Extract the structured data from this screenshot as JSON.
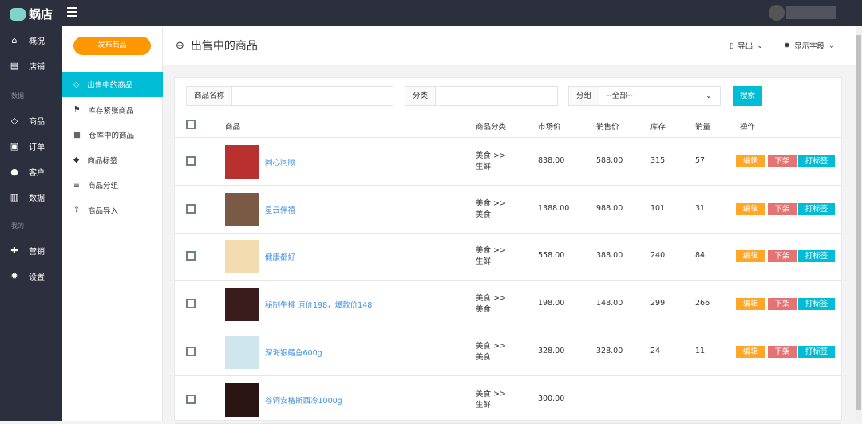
{
  "app": {
    "name": "蜗店"
  },
  "nav": {
    "items": [
      {
        "label": "概况",
        "icon": "home-icon",
        "glyph": "⌂"
      },
      {
        "label": "店铺",
        "icon": "store-icon",
        "glyph": "▤"
      }
    ],
    "section1": "数据",
    "items2": [
      {
        "label": "商品",
        "icon": "tag-icon",
        "glyph": "◇"
      },
      {
        "label": "订单",
        "icon": "order-icon",
        "glyph": "▣"
      },
      {
        "label": "客户",
        "icon": "user-icon",
        "glyph": "●"
      },
      {
        "label": "数据",
        "icon": "chart-icon",
        "glyph": "▥"
      }
    ],
    "section2": "我的",
    "items3": [
      {
        "label": "营销",
        "icon": "puzzle-icon",
        "glyph": "✚"
      },
      {
        "label": "设置",
        "icon": "gear-icon",
        "glyph": "✹"
      }
    ]
  },
  "sub": {
    "publish": "发布商品",
    "items": [
      {
        "label": "出售中的商品",
        "glyph": "◇"
      },
      {
        "label": "库存紧张商品",
        "glyph": "⚑"
      },
      {
        "label": "仓库中的商品",
        "glyph": "▦"
      },
      {
        "label": "商品标签",
        "glyph": "◆"
      },
      {
        "label": "商品分组",
        "glyph": "≣"
      },
      {
        "label": "商品导入",
        "glyph": "⇪"
      }
    ]
  },
  "header": {
    "title": "出售中的商品",
    "export": "导出",
    "fields": "显示字段"
  },
  "filters": {
    "name_label": "商品名称",
    "name_value": "",
    "category_label": "分类",
    "category_value": "",
    "group_label": "分组",
    "group_value": "--全部--",
    "search": "搜索"
  },
  "columns": [
    "商品",
    "商品分类",
    "市场价",
    "销售价",
    "库存",
    "销量",
    "操作"
  ],
  "actions": {
    "edit": "编辑",
    "off": "下架",
    "tag": "打标签"
  },
  "rows": [
    {
      "name": "同心同顺",
      "cat1": "美食 >>",
      "cat2": "生鲜",
      "market": "838.00",
      "price": "588.00",
      "stock": "315",
      "sales": "57",
      "img": "#b8312f"
    },
    {
      "name": "星云伴禧",
      "cat1": "美食 >>",
      "cat2": "美食",
      "market": "1388.00",
      "price": "988.00",
      "stock": "101",
      "sales": "31",
      "img": "#7a5a45"
    },
    {
      "name": "健康都好",
      "cat1": "美食 >>",
      "cat2": "生鲜",
      "market": "558.00",
      "price": "388.00",
      "stock": "240",
      "sales": "84",
      "img": "#f3dcb0"
    },
    {
      "name": "秘制牛排 原价198，爆款价148",
      "cat1": "美食 >>",
      "cat2": "美食",
      "market": "198.00",
      "price": "148.00",
      "stock": "299",
      "sales": "266",
      "img": "#3a1c1c"
    },
    {
      "name": "深海银鳕鱼600g",
      "cat1": "美食 >>",
      "cat2": "美食",
      "market": "328.00",
      "price": "328.00",
      "stock": "24",
      "sales": "11",
      "img": "#cfe6ef"
    },
    {
      "name": "谷饲安格斯西冷1000g",
      "cat1": "美食 >>",
      "cat2": "生鲜",
      "market": "300.00",
      "price": "",
      "stock": "",
      "sales": "",
      "img": "#2a1414"
    }
  ],
  "colors": {
    "accent": "#00bcd4",
    "orange": "#ff9800",
    "edit": "#ffa726",
    "off": "#e57373"
  }
}
